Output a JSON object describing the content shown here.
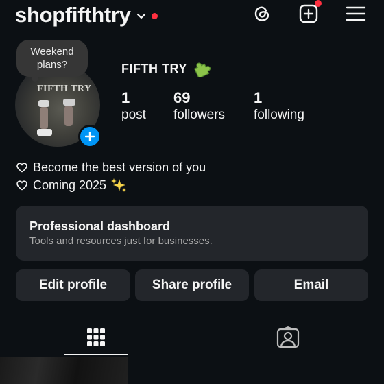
{
  "header": {
    "username": "shopfifthtry",
    "has_unread_dot": true,
    "icons": [
      "chevron-down-icon",
      "threads-icon",
      "create-post-icon",
      "menu-icon"
    ]
  },
  "profile": {
    "note": "Weekend plans?",
    "avatar_text": "FIFTH TRY",
    "display_name": "FIFTH TRY",
    "display_name_emoji": "puzzle-piece",
    "stats": {
      "posts": {
        "value": "1",
        "label": "post"
      },
      "followers": {
        "value": "69",
        "label": "followers"
      },
      "following": {
        "value": "1",
        "label": "following"
      }
    },
    "bio": [
      {
        "icon": "heart-outline-icon",
        "text": "Become the best version of you"
      },
      {
        "icon": "heart-outline-icon",
        "text": "Coming 2025",
        "suffix_icon": "sparkles-icon"
      }
    ]
  },
  "dashboard": {
    "title": "Professional dashboard",
    "subtitle": "Tools and resources just for businesses."
  },
  "actions": {
    "edit": "Edit profile",
    "share": "Share profile",
    "email": "Email"
  },
  "tabs": [
    {
      "name": "grid",
      "icon": "grid-icon",
      "active": true
    },
    {
      "name": "tagged",
      "icon": "tagged-person-icon",
      "active": false
    }
  ],
  "colors": {
    "background": "#0c1014",
    "surface": "#23262b",
    "accent_blue": "#0095f6",
    "notification_red": "#ff3040",
    "muted_text": "#a8a8a8"
  }
}
